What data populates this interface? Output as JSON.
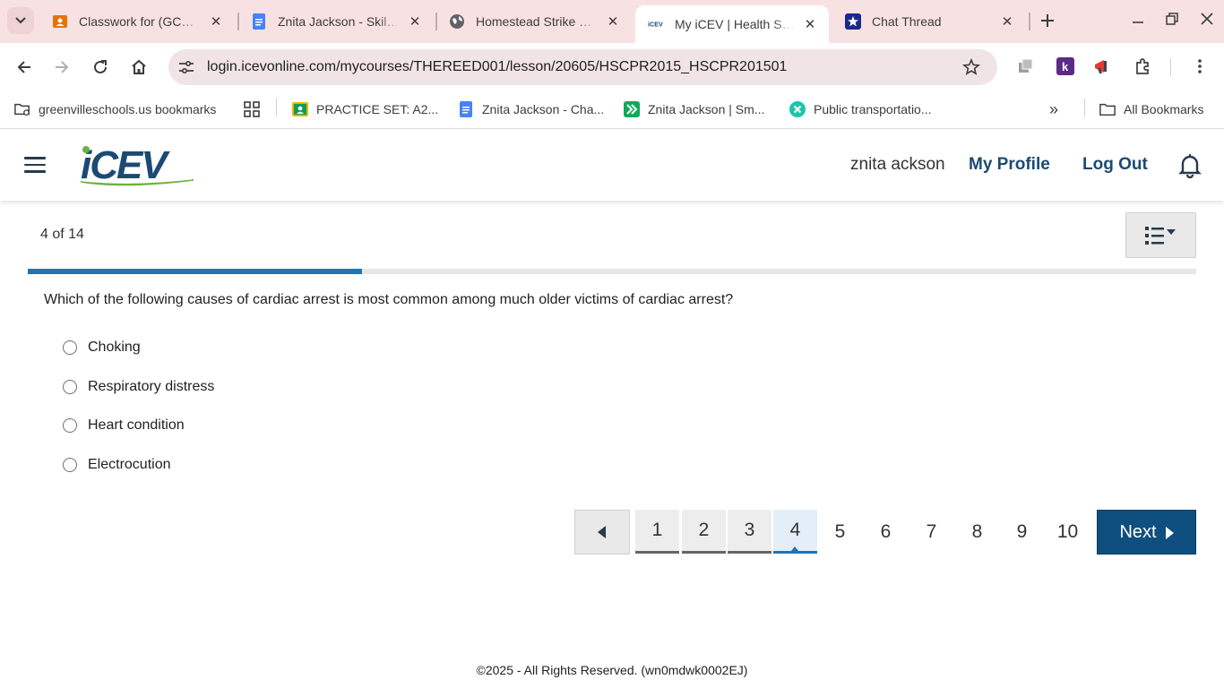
{
  "browser": {
    "tabs": [
      {
        "title": "Classwork for (GCS) F",
        "icon": "classroom-icon",
        "color": "#e8710a"
      },
      {
        "title": "Znita Jackson - Skilled",
        "icon": "docs-icon",
        "color": "#4285f4"
      },
      {
        "title": "Homestead Strike Sim",
        "icon": "globe-icon",
        "color": "#5f6368"
      },
      {
        "title": "My iCEV | Health Scie",
        "icon": "icev-icon",
        "color": "#1b4a73",
        "active": true
      },
      {
        "title": "Chat Thread",
        "icon": "star-badge-icon",
        "color": "#1a2a8c"
      }
    ],
    "url": "login.icevonline.com/mycourses/THEREED001/lesson/20605/HSCPR2015_HSCPR201501",
    "bookmarks": [
      {
        "label": "greenvilleschools.us bookmarks",
        "icon": "managed-folder-icon"
      },
      {
        "label": "",
        "icon": "apps-grid-icon"
      },
      {
        "label": "PRACTICE SET: A2...",
        "icon": "classroom-icon"
      },
      {
        "label": "Znita Jackson - Cha...",
        "icon": "docs-icon"
      },
      {
        "label": "Znita Jackson | Sm...",
        "icon": "smartpass-icon"
      },
      {
        "label": "Public transportatio...",
        "icon": "x-badge-icon"
      }
    ],
    "all_bookmarks": "All Bookmarks",
    "overflow": "»"
  },
  "header": {
    "user_name": "znita ackson",
    "my_profile": "My Profile",
    "log_out": "Log Out",
    "brand": "iCEV"
  },
  "lesson": {
    "position": "4 of 14",
    "progress": 0.2857,
    "question": "Which of the following causes of cardiac arrest is most common among much older victims of cardiac arrest?",
    "options": [
      "Choking",
      "Respiratory distress",
      "Heart condition",
      "Electrocution"
    ]
  },
  "pager": {
    "pages": [
      "1",
      "2",
      "3",
      "4",
      "5",
      "6",
      "7",
      "8",
      "9",
      "10"
    ],
    "current": "4",
    "visited": [
      "1",
      "2",
      "3"
    ],
    "next_label": "Next"
  },
  "footer": {
    "text": "©2025 - All Rights Reserved. (wn0mdwk0002EJ)"
  },
  "colors": {
    "accent": "#1f73b7",
    "next_button": "#0f4f7f",
    "header_link": "#1b4a73",
    "tabstrip": "#f8e1e3"
  }
}
